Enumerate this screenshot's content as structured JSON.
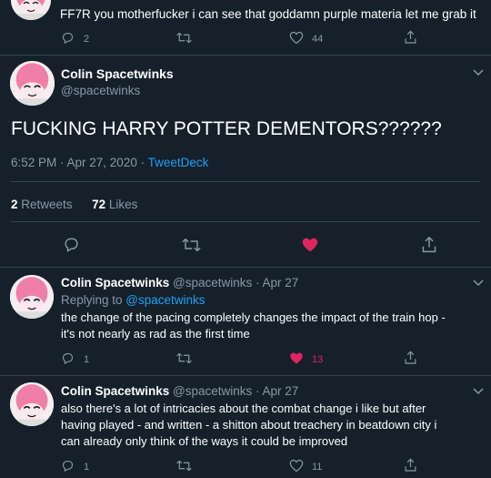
{
  "colors": {
    "background": "#15202b",
    "text": "#ffffff",
    "muted": "#8899a6",
    "accent": "#1da1f2",
    "like_active": "#e0245e",
    "divider": "#38444d"
  },
  "top_tweet": {
    "text": "FF7R you motherfucker i can see that goddamn purple materia let me grab it",
    "replies": "2",
    "likes": "44",
    "icons": [
      "reply-icon",
      "retweet-icon",
      "like-icon",
      "share-icon"
    ]
  },
  "main_tweet": {
    "display_name": "Colin Spacetwinks",
    "handle": "@spacetwinks",
    "text": "FUCKING HARRY POTTER DEMENTORS??????",
    "time": "6:52 PM · Apr 27, 2020 · ",
    "source": "TweetDeck",
    "retweet_count": "2",
    "retweet_label": "Retweets",
    "like_count": "72",
    "like_label": "Likes",
    "icons": [
      "reply-icon",
      "retweet-icon",
      "like-icon-filled",
      "share-icon"
    ]
  },
  "replies": [
    {
      "display_name": "Colin Spacetwinks",
      "handle_date": "@spacetwinks · Apr 27",
      "replying_label": "Replying to ",
      "replying_to": "@spacetwinks",
      "text_line1": "the change of the pacing completely changes the impact of the train hop -",
      "text_line2": "it's not nearly as rad as the first time",
      "replies": "1",
      "likes": "13",
      "liked": true
    },
    {
      "display_name": "Colin Spacetwinks",
      "handle_date": "@spacetwinks · Apr 27",
      "text_line1": "also there's a lot of intricacies about the combat change i like but after",
      "text_line2": "having played - and written - a shitton about treachery in beatdown city i",
      "text_line3": "can already only think of the ways it could be improved",
      "replies": "1",
      "likes": "11",
      "liked": false
    }
  ]
}
